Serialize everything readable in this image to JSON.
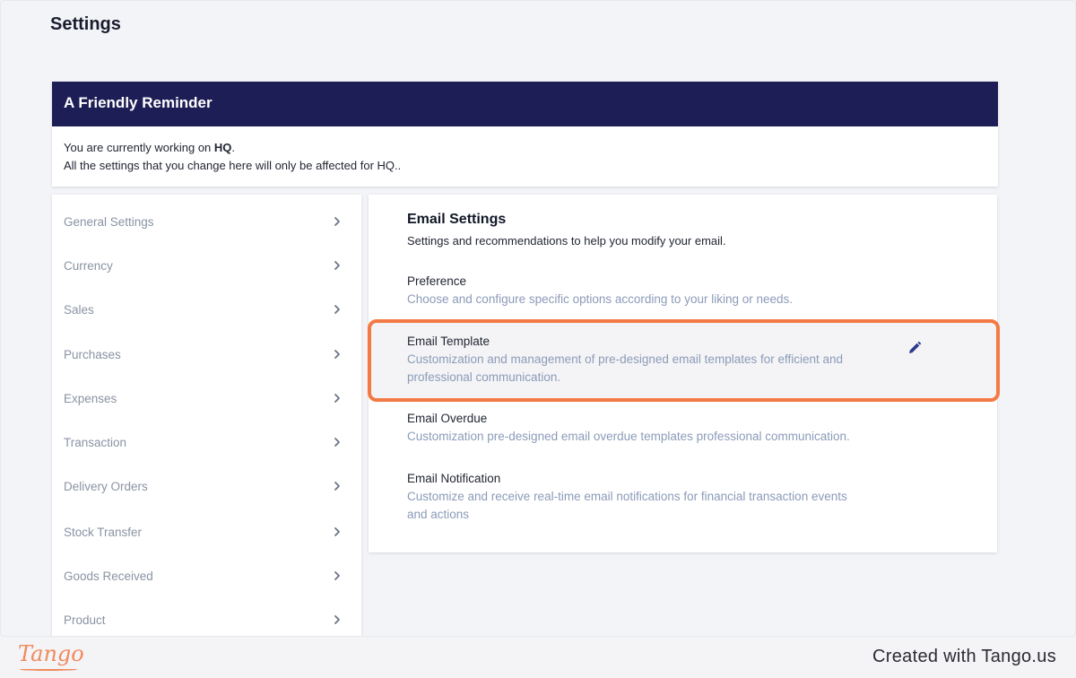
{
  "page": {
    "title": "Settings"
  },
  "reminder": {
    "title": "A Friendly Reminder",
    "line1_prefix": "You are currently working on ",
    "line1_bold": "HQ",
    "line1_suffix": ".",
    "line2": "All the settings that you change here will only be affected for HQ.."
  },
  "sidebar": {
    "items": [
      {
        "label": "General Settings",
        "icon": "chevron-right-icon"
      },
      {
        "label": "Currency",
        "icon": "chevron-right-icon"
      },
      {
        "label": "Sales",
        "icon": "chevron-right-icon"
      },
      {
        "label": "Purchases",
        "icon": "chevron-right-icon"
      },
      {
        "label": "Expenses",
        "icon": "chevron-right-icon"
      },
      {
        "label": "Transaction",
        "icon": "chevron-right-icon"
      },
      {
        "label": "Delivery Orders",
        "icon": "chevron-right-icon"
      },
      {
        "label": "Stock Transfer",
        "icon": "chevron-right-icon"
      },
      {
        "label": "Goods Received",
        "icon": "chevron-right-icon"
      },
      {
        "label": "Product",
        "icon": "chevron-right-icon"
      }
    ]
  },
  "main": {
    "title": "Email Settings",
    "subtitle": "Settings and recommendations to help you modify your email.",
    "options": [
      {
        "title": "Preference",
        "desc": "Choose and configure specific options according to your liking or needs."
      },
      {
        "title": "Email Template",
        "desc": "Customization and management of pre-designed email templates for efficient and professional communication.",
        "icon": "pencil-icon"
      },
      {
        "title": "Email Overdue",
        "desc": "Customization pre-designed email overdue templates professional communication."
      },
      {
        "title": "Email Notification",
        "desc": "Customize and receive real-time email notifications for financial transaction events and actions"
      }
    ]
  },
  "footer": {
    "logo": "Tango",
    "credit": "Created with Tango.us"
  },
  "colors": {
    "reminder_header": "#1e1e56",
    "highlight_ring": "#f47a45",
    "muted_text": "#8b9bb8",
    "edit_icon": "#2d3a8c"
  }
}
